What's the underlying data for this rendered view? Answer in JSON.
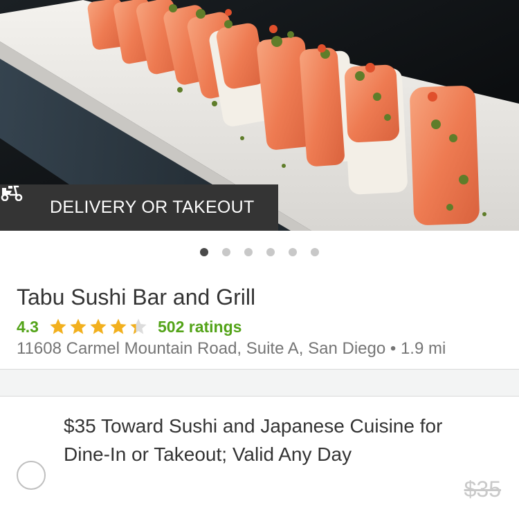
{
  "hero": {
    "badge_icon": "scooter-icon",
    "badge_label": "DELIVERY OR TAKEOUT"
  },
  "carousel": {
    "total_dots": 6,
    "active_index": 0
  },
  "merchant": {
    "name": "Tabu Sushi Bar and Grill",
    "rating": "4.3",
    "rating_value": 4.3,
    "ratings_count": "502 ratings",
    "address": "11608 Carmel Mountain Road, Suite A, San Diego • 1.9 mi"
  },
  "option": {
    "title": "$35 Toward Sushi and Japanese Cuisine for Dine-In or Takeout; Valid Any Day",
    "original_price": "$35"
  },
  "colors": {
    "accent_green": "#53a318",
    "star_gold": "#f2b01e",
    "badge_bg": "#343434"
  }
}
